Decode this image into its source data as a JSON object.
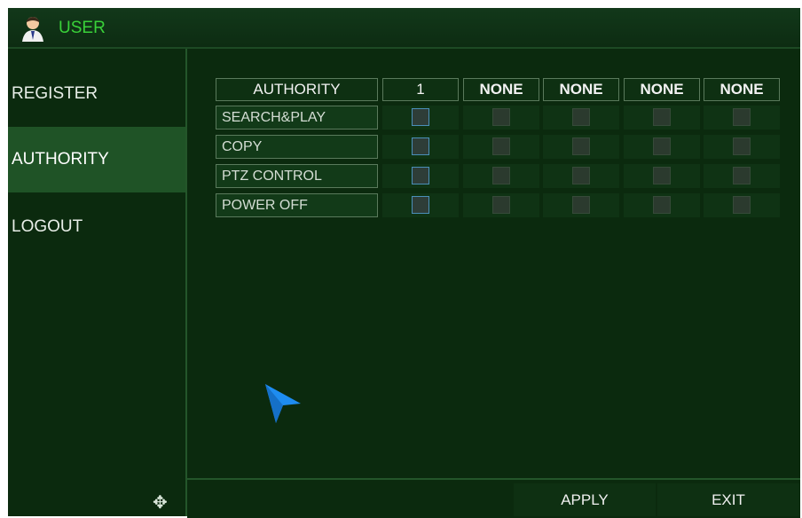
{
  "window": {
    "title": "USER",
    "title_icon": "user-icon"
  },
  "sidebar": {
    "items": [
      {
        "label": "REGISTER",
        "active": false
      },
      {
        "label": "AUTHORITY",
        "active": true
      },
      {
        "label": "LOGOUT",
        "active": false
      }
    ],
    "move_icon": "move-arrows-icon"
  },
  "authority_table": {
    "header_label": "AUTHORITY",
    "user_columns": [
      "1",
      "NONE",
      "NONE",
      "NONE",
      "NONE"
    ],
    "rows": [
      {
        "label": "SEARCH&PLAY",
        "checked": [
          false,
          false,
          false,
          false,
          false
        ]
      },
      {
        "label": "COPY",
        "checked": [
          false,
          false,
          false,
          false,
          false
        ]
      },
      {
        "label": "PTZ CONTROL",
        "checked": [
          false,
          false,
          false,
          false,
          false
        ]
      },
      {
        "label": "POWER OFF",
        "checked": [
          false,
          false,
          false,
          false,
          false
        ]
      }
    ]
  },
  "footer": {
    "apply_label": "APPLY",
    "exit_label": "EXIT"
  },
  "colors": {
    "accent": "#39d139",
    "background": "#0b2a0e",
    "active_item": "#1f5326",
    "cursor": "#1e8cf0"
  }
}
